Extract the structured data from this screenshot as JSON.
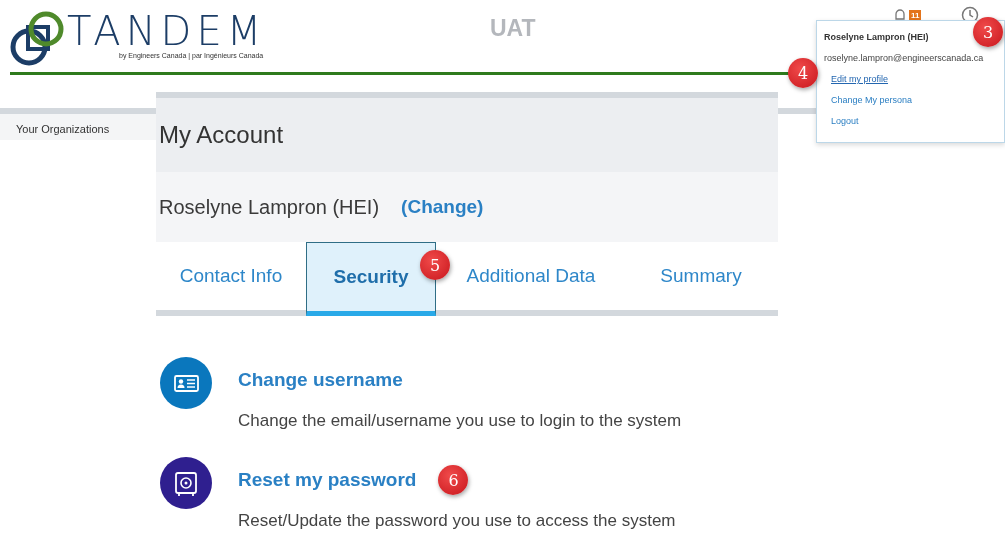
{
  "header": {
    "logo_title": "TANDEM",
    "logo_subtitle": "by Engineers Canada | par Ingénieurs Canada",
    "environment": "UAT",
    "notification_count": "11"
  },
  "sidebar": {
    "items": [
      {
        "label": "Your Organizations"
      }
    ]
  },
  "account": {
    "title": "My Account",
    "user_name": "Roselyne Lampron (HEI)",
    "change_link": "(Change)"
  },
  "tabs": [
    {
      "label": "Contact Info",
      "selected": false
    },
    {
      "label": "Security",
      "selected": true,
      "marker": "5"
    },
    {
      "label": "Additional Data",
      "selected": false
    },
    {
      "label": "Summary",
      "selected": false
    }
  ],
  "options": [
    {
      "kind": "username",
      "title": "Change username",
      "description": "Change the email/username you use to login to the system"
    },
    {
      "kind": "password",
      "title": "Reset my password",
      "description": "Reset/Update the password you use to access the system",
      "marker": "6"
    }
  ],
  "user_menu": {
    "name": "Roselyne Lampron (HEI)",
    "email": "roselyne.lampron@engineerscanada.ca",
    "marker": "3",
    "items": [
      {
        "label": "Edit my profile",
        "hovered": true,
        "marker": "4"
      },
      {
        "label": "Change My persona",
        "hovered": false
      },
      {
        "label": "Logout",
        "hovered": false
      }
    ]
  }
}
